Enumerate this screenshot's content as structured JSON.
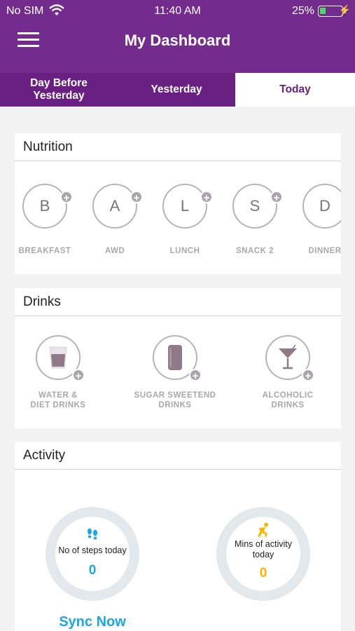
{
  "status_bar": {
    "carrier": "No SIM",
    "time": "11:40 AM",
    "battery": "25%"
  },
  "header": {
    "title": "My Dashboard"
  },
  "tabs": [
    {
      "label": "Day Before Yesterday"
    },
    {
      "label": "Yesterday"
    },
    {
      "label": "Today",
      "selected": true
    }
  ],
  "nutrition": {
    "title": "Nutrition",
    "meals": [
      {
        "letter": "B",
        "label": "BREAKFAST"
      },
      {
        "letter": "A",
        "label": "AWD"
      },
      {
        "letter": "L",
        "label": "LUNCH"
      },
      {
        "letter": "S",
        "label": "SNACK 2"
      },
      {
        "letter": "D",
        "label": "DINNER"
      }
    ]
  },
  "drinks": {
    "title": "Drinks",
    "items": [
      {
        "line1": "WATER &",
        "line2": "DIET DRINKS",
        "icon": "water-glass-icon"
      },
      {
        "line1": "SUGAR SWEETEND",
        "line2": "DRINKS",
        "icon": "soda-can-icon"
      },
      {
        "line1": "ALCOHOLIC",
        "line2": "DRINKS",
        "icon": "cocktail-glass-icon"
      }
    ]
  },
  "activity": {
    "title": "Activity",
    "steps": {
      "label": "No of steps today",
      "value": "0",
      "icon": "footsteps-icon",
      "color": "#1ba7e0"
    },
    "minutes": {
      "label": "Mins of activity today",
      "value": "0",
      "icon": "running-icon",
      "color": "#f5b800"
    },
    "sync_label": "Sync Now"
  },
  "colors": {
    "brand": "#742b8e",
    "accent": "#1ba7e0",
    "activity": "#f5b800"
  }
}
